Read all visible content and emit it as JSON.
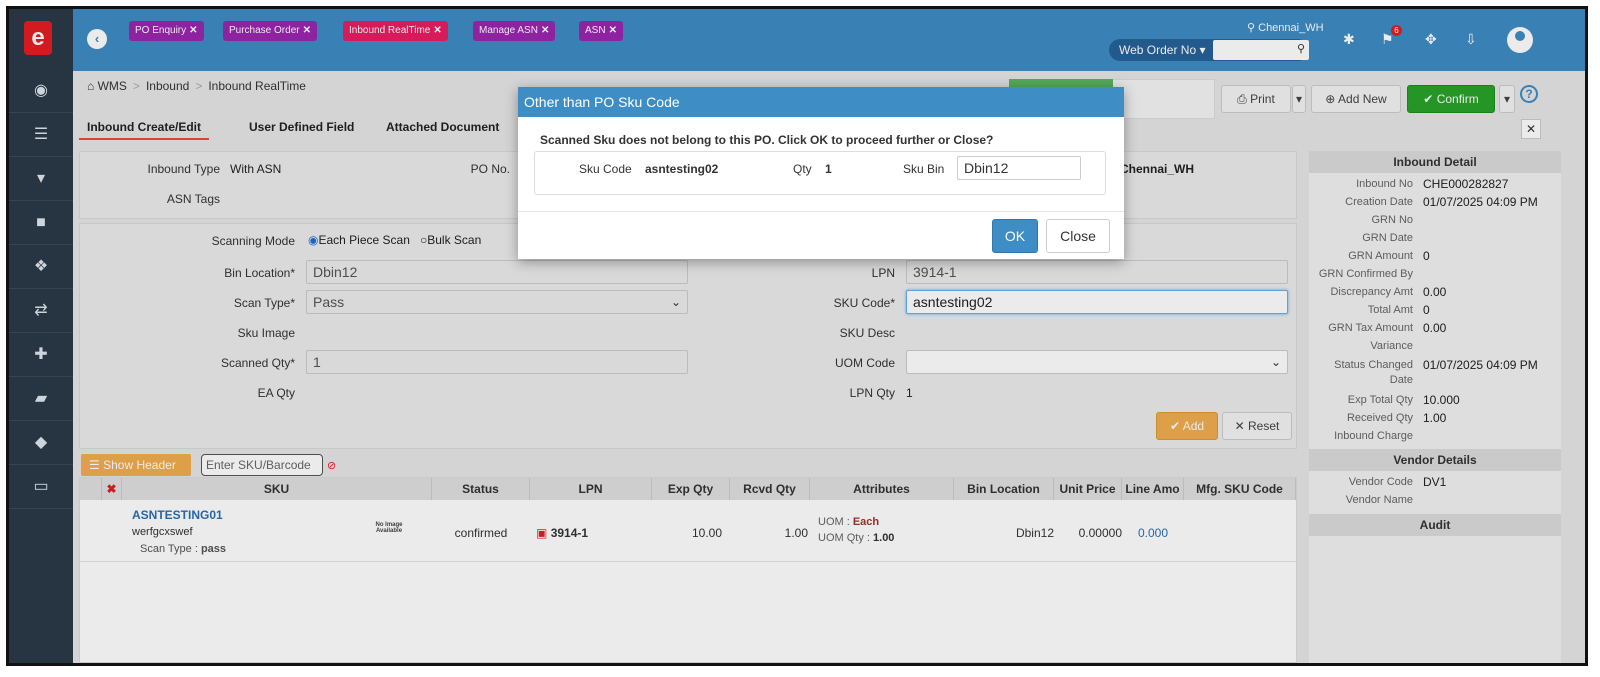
{
  "app": {
    "logo": "e"
  },
  "tabs": [
    {
      "label": "PO Enquiry",
      "color": "#9b27b0"
    },
    {
      "label": "Purchase Order",
      "color": "#9b27b0"
    },
    {
      "label": "Inbound RealTime",
      "color": "#e91e63"
    },
    {
      "label": "Manage ASN",
      "color": "#9b27b0"
    },
    {
      "label": "ASN",
      "color": "#9b27b0"
    }
  ],
  "header": {
    "location": "Chennai_WH",
    "search_type": "Web Order No",
    "notif_count": "6"
  },
  "breadcrumb": {
    "home": "WMS",
    "level1": "Inbound",
    "level2": "Inbound RealTime"
  },
  "toolbar": {
    "print": "Print",
    "add_new": "Add New",
    "confirm": "Confirm"
  },
  "subtabs": [
    "Inbound Create/Edit",
    "User Defined Field",
    "Attached Document"
  ],
  "header_form": {
    "inbound_type_label": "Inbound Type",
    "inbound_type": "With ASN",
    "po_no_label": "PO No.",
    "asn_tags_label": "ASN Tags",
    "warehouse": "Chennai_WH"
  },
  "scan_form": {
    "scanning_mode_label": "Scanning Mode",
    "mode_each": "Each Piece Scan",
    "mode_bulk": "Bulk Scan",
    "bin_location_label": "Bin Location*",
    "bin_location": "Dbin12",
    "scan_type_label": "Scan Type*",
    "scan_type": "Pass",
    "sku_image_label": "Sku Image",
    "scanned_qty_label": "Scanned Qty*",
    "scanned_qty": "1",
    "ea_qty_label": "EA Qty",
    "lpn_label": "LPN",
    "lpn": "3914-1",
    "sku_code_label": "SKU Code*",
    "sku_code": "asntesting02",
    "sku_desc_label": "SKU Desc",
    "uom_code_label": "UOM Code",
    "lpn_qty_label": "LPN Qty",
    "lpn_qty": "1",
    "add": "Add",
    "reset": "Reset"
  },
  "list_toolbar": {
    "show_header": "Show Header",
    "sku_placeholder": "Enter SKU/Barcode"
  },
  "table": {
    "columns": [
      "SKU",
      "Status",
      "LPN",
      "Exp Qty",
      "Rcvd Qty",
      "Attributes",
      "Bin Location",
      "Unit Price",
      "Line Amo",
      "Mfg. SKU Code"
    ],
    "rows": [
      {
        "sku": "ASNTESTING01",
        "desc": "werfgcxswef",
        "scan_type_label": "Scan Type :",
        "scan_type": "pass",
        "no_image": "No Image Available",
        "status": "confirmed",
        "lpn": "3914-1",
        "exp_qty": "10.00",
        "rcvd_qty": "1.00",
        "uom_label": "UOM :",
        "uom": "Each",
        "uom_qty_label": "UOM Qty :",
        "uom_qty": "1.00",
        "bin": "Dbin12",
        "unit_price": "0.00000",
        "line_amount": "0.000"
      }
    ]
  },
  "inbound_detail": {
    "title": "Inbound Detail",
    "fields": [
      {
        "label": "Inbound No",
        "value": "CHE000282827"
      },
      {
        "label": "Creation Date",
        "value": "01/07/2025 04:09 PM"
      },
      {
        "label": "GRN No",
        "value": ""
      },
      {
        "label": "GRN Date",
        "value": ""
      },
      {
        "label": "GRN Amount",
        "value": "0"
      },
      {
        "label": "GRN Confirmed By",
        "value": ""
      },
      {
        "label": "Discrepancy Amt",
        "value": "0.00"
      },
      {
        "label": "Total Amt",
        "value": "0"
      },
      {
        "label": "GRN Tax Amount",
        "value": "0.00"
      },
      {
        "label": "Variance",
        "value": ""
      },
      {
        "label": "Status Changed Date",
        "value": "01/07/2025 04:09 PM"
      },
      {
        "label": "Exp Total Qty",
        "value": "10.000"
      },
      {
        "label": "Received Qty",
        "value": "1.00"
      },
      {
        "label": "Inbound Charge",
        "value": ""
      }
    ]
  },
  "vendor_details": {
    "title": "Vendor Details",
    "code_label": "Vendor Code",
    "code": "DV1",
    "name_label": "Vendor Name"
  },
  "audit": {
    "title": "Audit"
  },
  "modal": {
    "title": "Other than PO Sku Code",
    "message": "Scanned Sku does not belong to this PO. Click OK to proceed further or Close?",
    "sku_code_label": "Sku Code",
    "sku_code": "asntesting02",
    "qty_label": "Qty",
    "qty": "1",
    "sku_bin_label": "Sku Bin",
    "sku_bin": "Dbin12",
    "ok": "OK",
    "close": "Close"
  }
}
